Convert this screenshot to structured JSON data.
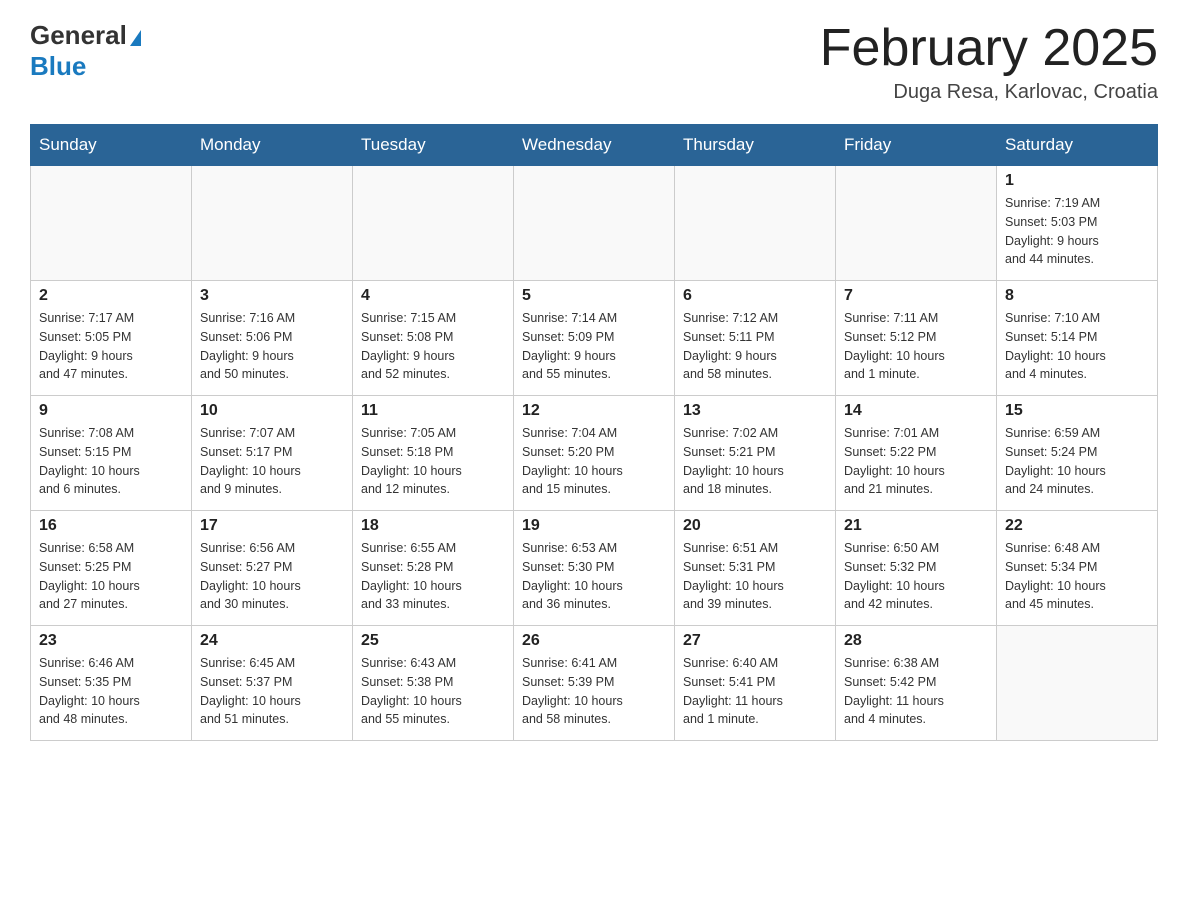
{
  "header": {
    "logo_line1": "General",
    "logo_line2": "Blue",
    "month_title": "February 2025",
    "location": "Duga Resa, Karlovac, Croatia"
  },
  "weekdays": [
    "Sunday",
    "Monday",
    "Tuesday",
    "Wednesday",
    "Thursday",
    "Friday",
    "Saturday"
  ],
  "weeks": [
    [
      {
        "day": "",
        "info": ""
      },
      {
        "day": "",
        "info": ""
      },
      {
        "day": "",
        "info": ""
      },
      {
        "day": "",
        "info": ""
      },
      {
        "day": "",
        "info": ""
      },
      {
        "day": "",
        "info": ""
      },
      {
        "day": "1",
        "info": "Sunrise: 7:19 AM\nSunset: 5:03 PM\nDaylight: 9 hours\nand 44 minutes."
      }
    ],
    [
      {
        "day": "2",
        "info": "Sunrise: 7:17 AM\nSunset: 5:05 PM\nDaylight: 9 hours\nand 47 minutes."
      },
      {
        "day": "3",
        "info": "Sunrise: 7:16 AM\nSunset: 5:06 PM\nDaylight: 9 hours\nand 50 minutes."
      },
      {
        "day": "4",
        "info": "Sunrise: 7:15 AM\nSunset: 5:08 PM\nDaylight: 9 hours\nand 52 minutes."
      },
      {
        "day": "5",
        "info": "Sunrise: 7:14 AM\nSunset: 5:09 PM\nDaylight: 9 hours\nand 55 minutes."
      },
      {
        "day": "6",
        "info": "Sunrise: 7:12 AM\nSunset: 5:11 PM\nDaylight: 9 hours\nand 58 minutes."
      },
      {
        "day": "7",
        "info": "Sunrise: 7:11 AM\nSunset: 5:12 PM\nDaylight: 10 hours\nand 1 minute."
      },
      {
        "day": "8",
        "info": "Sunrise: 7:10 AM\nSunset: 5:14 PM\nDaylight: 10 hours\nand 4 minutes."
      }
    ],
    [
      {
        "day": "9",
        "info": "Sunrise: 7:08 AM\nSunset: 5:15 PM\nDaylight: 10 hours\nand 6 minutes."
      },
      {
        "day": "10",
        "info": "Sunrise: 7:07 AM\nSunset: 5:17 PM\nDaylight: 10 hours\nand 9 minutes."
      },
      {
        "day": "11",
        "info": "Sunrise: 7:05 AM\nSunset: 5:18 PM\nDaylight: 10 hours\nand 12 minutes."
      },
      {
        "day": "12",
        "info": "Sunrise: 7:04 AM\nSunset: 5:20 PM\nDaylight: 10 hours\nand 15 minutes."
      },
      {
        "day": "13",
        "info": "Sunrise: 7:02 AM\nSunset: 5:21 PM\nDaylight: 10 hours\nand 18 minutes."
      },
      {
        "day": "14",
        "info": "Sunrise: 7:01 AM\nSunset: 5:22 PM\nDaylight: 10 hours\nand 21 minutes."
      },
      {
        "day": "15",
        "info": "Sunrise: 6:59 AM\nSunset: 5:24 PM\nDaylight: 10 hours\nand 24 minutes."
      }
    ],
    [
      {
        "day": "16",
        "info": "Sunrise: 6:58 AM\nSunset: 5:25 PM\nDaylight: 10 hours\nand 27 minutes."
      },
      {
        "day": "17",
        "info": "Sunrise: 6:56 AM\nSunset: 5:27 PM\nDaylight: 10 hours\nand 30 minutes."
      },
      {
        "day": "18",
        "info": "Sunrise: 6:55 AM\nSunset: 5:28 PM\nDaylight: 10 hours\nand 33 minutes."
      },
      {
        "day": "19",
        "info": "Sunrise: 6:53 AM\nSunset: 5:30 PM\nDaylight: 10 hours\nand 36 minutes."
      },
      {
        "day": "20",
        "info": "Sunrise: 6:51 AM\nSunset: 5:31 PM\nDaylight: 10 hours\nand 39 minutes."
      },
      {
        "day": "21",
        "info": "Sunrise: 6:50 AM\nSunset: 5:32 PM\nDaylight: 10 hours\nand 42 minutes."
      },
      {
        "day": "22",
        "info": "Sunrise: 6:48 AM\nSunset: 5:34 PM\nDaylight: 10 hours\nand 45 minutes."
      }
    ],
    [
      {
        "day": "23",
        "info": "Sunrise: 6:46 AM\nSunset: 5:35 PM\nDaylight: 10 hours\nand 48 minutes."
      },
      {
        "day": "24",
        "info": "Sunrise: 6:45 AM\nSunset: 5:37 PM\nDaylight: 10 hours\nand 51 minutes."
      },
      {
        "day": "25",
        "info": "Sunrise: 6:43 AM\nSunset: 5:38 PM\nDaylight: 10 hours\nand 55 minutes."
      },
      {
        "day": "26",
        "info": "Sunrise: 6:41 AM\nSunset: 5:39 PM\nDaylight: 10 hours\nand 58 minutes."
      },
      {
        "day": "27",
        "info": "Sunrise: 6:40 AM\nSunset: 5:41 PM\nDaylight: 11 hours\nand 1 minute."
      },
      {
        "day": "28",
        "info": "Sunrise: 6:38 AM\nSunset: 5:42 PM\nDaylight: 11 hours\nand 4 minutes."
      },
      {
        "day": "",
        "info": ""
      }
    ]
  ]
}
